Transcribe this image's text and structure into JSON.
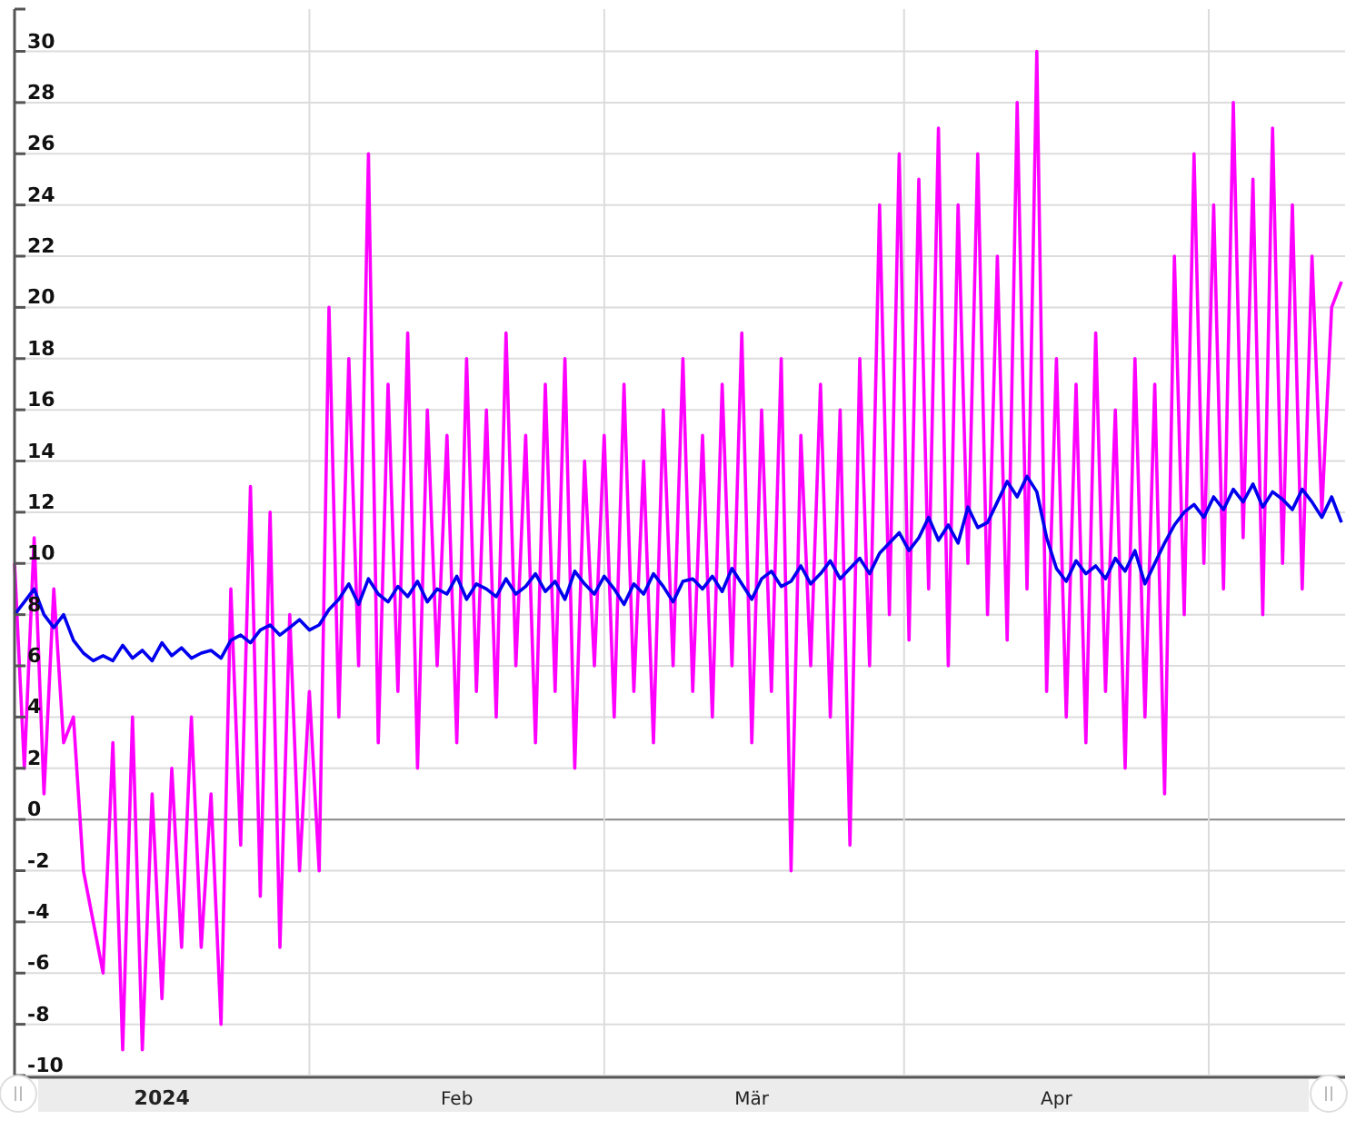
{
  "chart": {
    "chart_data": {
      "type": "line",
      "categories": [
        null,
        null,
        null,
        null,
        null,
        null,
        null,
        null,
        null,
        null,
        null,
        null,
        null,
        null,
        null,
        "2024",
        null,
        null,
        null,
        null,
        null,
        null,
        null,
        null,
        null,
        null,
        null,
        null,
        null,
        null,
        null,
        null,
        null,
        null,
        null,
        null,
        null,
        null,
        null,
        null,
        null,
        null,
        null,
        null,
        null,
        "Feb",
        null,
        null,
        null,
        null,
        null,
        null,
        null,
        null,
        null,
        null,
        null,
        null,
        null,
        null,
        null,
        null,
        null,
        null,
        null,
        null,
        null,
        null,
        null,
        null,
        null,
        null,
        null,
        null,
        null,
        "Mär",
        null,
        null,
        null,
        null,
        null,
        null,
        null,
        null,
        null,
        null,
        null,
        null,
        null,
        null,
        null,
        null,
        null,
        null,
        null,
        null,
        null,
        null,
        null,
        null,
        null,
        null,
        null,
        null,
        null,
        null,
        "Apr",
        null,
        null,
        null,
        null,
        null,
        null,
        null,
        null,
        null,
        null,
        null,
        null,
        null,
        null,
        null,
        null,
        null,
        null,
        null,
        null,
        null,
        null,
        null,
        null,
        null,
        null,
        null,
        null,
        null
      ],
      "series": [
        {
          "color": "#ff00ff",
          "values": [
            10,
            2,
            11,
            1,
            9,
            3,
            4,
            -2,
            -4,
            -6,
            3,
            -9,
            4,
            -9,
            1,
            -7,
            2,
            -5,
            4,
            -5,
            1,
            -8,
            9,
            -1,
            13,
            -3,
            12,
            -5,
            8,
            -2,
            5,
            -2,
            20,
            4,
            18,
            6,
            26,
            3,
            17,
            5,
            19,
            2,
            16,
            6,
            15,
            3,
            18,
            5,
            16,
            4,
            19,
            6,
            15,
            3,
            17,
            5,
            18,
            2,
            14,
            6,
            15,
            4,
            17,
            5,
            14,
            3,
            16,
            6,
            18,
            5,
            15,
            4,
            17,
            6,
            19,
            3,
            16,
            5,
            18,
            -2,
            15,
            6,
            17,
            4,
            16,
            -1,
            18,
            6,
            24,
            8,
            26,
            7,
            25,
            9,
            27,
            6,
            24,
            10,
            26,
            8,
            22,
            7,
            28,
            9,
            30,
            5,
            18,
            4,
            17,
            3,
            19,
            5,
            16,
            2,
            18,
            4,
            17,
            1,
            22,
            8,
            26,
            10,
            24,
            9,
            28,
            11,
            25,
            8,
            27,
            10,
            24,
            9,
            22,
            12,
            20,
            21
          ]
        },
        {
          "color": "#0000ee",
          "values": [
            8,
            8.5,
            9,
            8,
            7.5,
            8,
            7,
            6.5,
            6.2,
            6.4,
            6.2,
            6.8,
            6.3,
            6.6,
            6.2,
            6.9,
            6.4,
            6.7,
            6.3,
            6.5,
            6.6,
            6.3,
            7,
            7.2,
            6.9,
            7.4,
            7.6,
            7.2,
            7.5,
            7.8,
            7.4,
            7.6,
            8.2,
            8.6,
            9.2,
            8.4,
            9.4,
            8.8,
            8.5,
            9.1,
            8.7,
            9.3,
            8.5,
            9,
            8.8,
            9.5,
            8.6,
            9.2,
            9,
            8.7,
            9.4,
            8.8,
            9.1,
            9.6,
            8.9,
            9.3,
            8.6,
            9.7,
            9.2,
            8.8,
            9.5,
            9,
            8.4,
            9.2,
            8.8,
            9.6,
            9.1,
            8.5,
            9.3,
            9.4,
            9,
            9.5,
            8.9,
            9.8,
            9.2,
            8.6,
            9.4,
            9.7,
            9.1,
            9.3,
            9.9,
            9.2,
            9.6,
            10.1,
            9.4,
            9.8,
            10.2,
            9.6,
            10.4,
            10.8,
            11.2,
            10.5,
            11,
            11.8,
            10.9,
            11.5,
            10.8,
            12.2,
            11.4,
            11.6,
            12.4,
            13.2,
            12.6,
            13.4,
            12.8,
            11,
            9.8,
            9.3,
            10.1,
            9.6,
            9.9,
            9.4,
            10.2,
            9.7,
            10.5,
            9.2,
            10,
            10.8,
            11.5,
            12,
            12.3,
            11.8,
            12.6,
            12.1,
            12.9,
            12.4,
            13.1,
            12.2,
            12.8,
            12.5,
            12.1,
            12.9,
            12.4,
            11.8,
            12.6,
            11.6
          ]
        }
      ],
      "ylim": [
        -10,
        31.65
      ],
      "grid": true,
      "yticks": [
        -10,
        -8,
        -6,
        -4,
        -2,
        0,
        2,
        4,
        6,
        8,
        10,
        12,
        14,
        16,
        18,
        20,
        22,
        24,
        26,
        28,
        30
      ]
    }
  }
}
